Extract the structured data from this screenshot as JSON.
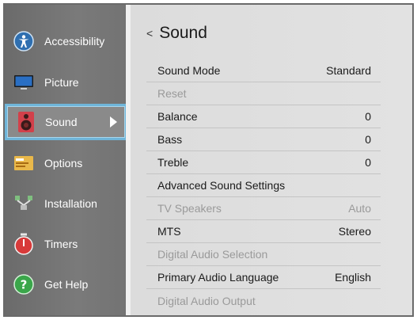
{
  "sidebar": {
    "items": [
      {
        "label": "Accessibility",
        "icon": "accessibility-icon"
      },
      {
        "label": "Picture",
        "icon": "monitor-icon"
      },
      {
        "label": "Sound",
        "icon": "speaker-icon"
      },
      {
        "label": "Options",
        "icon": "options-icon"
      },
      {
        "label": "Installation",
        "icon": "network-icon"
      },
      {
        "label": "Timers",
        "icon": "timer-icon"
      },
      {
        "label": "Get Help",
        "icon": "help-icon"
      }
    ],
    "selected": "Sound"
  },
  "main": {
    "back_glyph": "<",
    "title": "Sound",
    "rows": [
      {
        "label": "Sound Mode",
        "value": "Standard",
        "enabled": true
      },
      {
        "label": "Reset",
        "value": "",
        "enabled": false
      },
      {
        "label": "Balance",
        "value": "0",
        "enabled": true
      },
      {
        "label": "Bass",
        "value": "0",
        "enabled": true
      },
      {
        "label": "Treble",
        "value": "0",
        "enabled": true
      },
      {
        "label": "Advanced Sound Settings",
        "value": "",
        "enabled": true
      },
      {
        "label": "TV Speakers",
        "value": "Auto",
        "enabled": false
      },
      {
        "label": "MTS",
        "value": "Stereo",
        "enabled": true
      },
      {
        "label": "Digital Audio Selection",
        "value": "",
        "enabled": false
      },
      {
        "label": "Primary Audio Language",
        "value": "English",
        "enabled": true
      },
      {
        "label": "Digital Audio Output",
        "value": "",
        "enabled": false
      }
    ]
  },
  "colors": {
    "sidebar_bg": "#757575",
    "selection_border": "#6fb5d9",
    "panel_bg": "#dfdfdf",
    "disabled_text": "#9a9a9a"
  }
}
